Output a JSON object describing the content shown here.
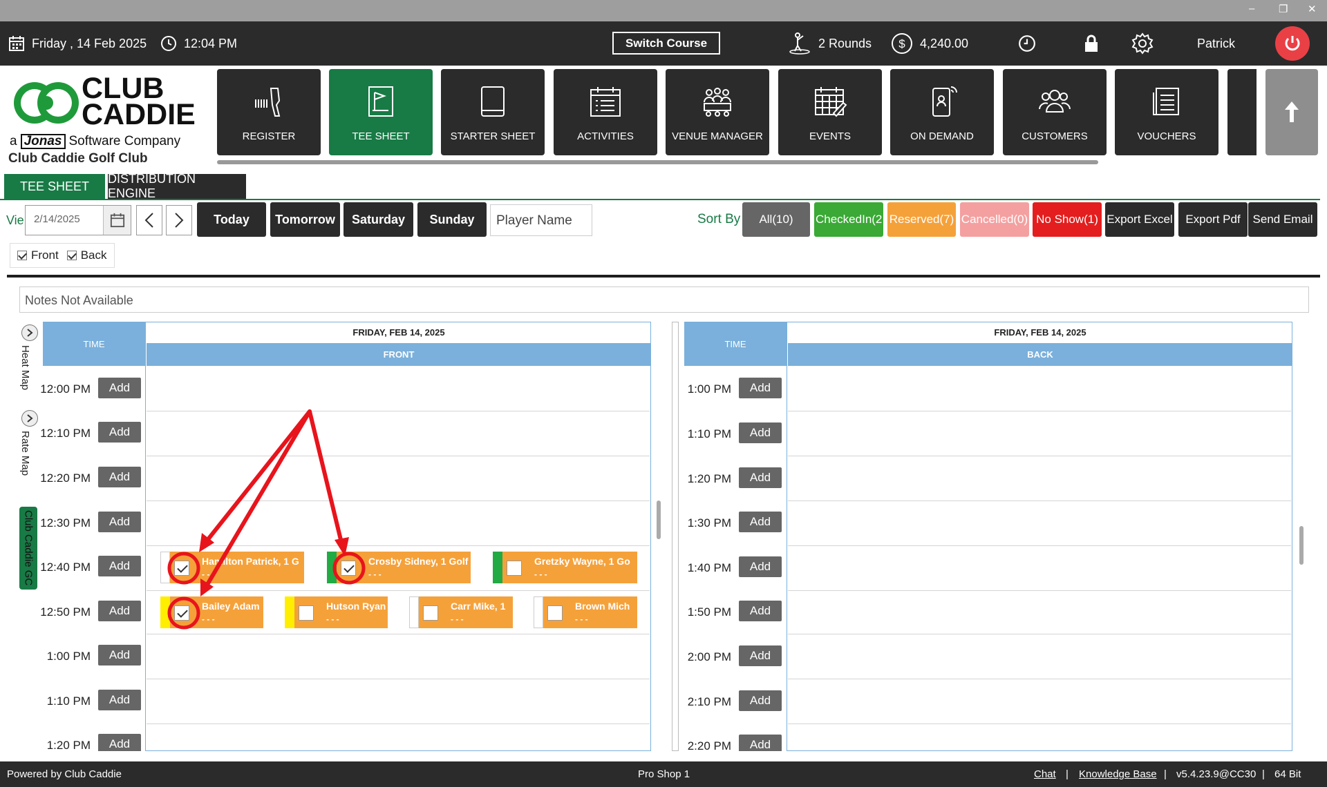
{
  "window": {
    "minimize": "–",
    "restore": "❐",
    "close": "✕"
  },
  "topbar": {
    "date": "Friday ,  14 Feb 2025",
    "time": "12:04 PM",
    "switch_course": "Switch Course",
    "rounds": "2 Rounds",
    "balance": "4,240.00",
    "user": "Patrick"
  },
  "logo": {
    "line1": "CLUB",
    "line2": "CADDIE",
    "tagline_a": "a",
    "tagline_brand": "Jonas",
    "tagline_rest": "Software Company"
  },
  "club_name": "Club Caddie Golf Club",
  "nav": [
    {
      "label": "REGISTER",
      "icon": "barcode-scanner-icon"
    },
    {
      "label": "TEE SHEET",
      "icon": "tee-sheet-icon"
    },
    {
      "label": "STARTER SHEET",
      "icon": "tablet-icon"
    },
    {
      "label": "ACTIVITIES",
      "icon": "calendar-list-icon"
    },
    {
      "label": "VENUE MANAGER",
      "icon": "venue-icon"
    },
    {
      "label": "EVENTS",
      "icon": "calendar-edit-icon"
    },
    {
      "label": "ON DEMAND",
      "icon": "phone-ring-icon"
    },
    {
      "label": "CUSTOMERS",
      "icon": "people-icon"
    },
    {
      "label": "VOUCHERS",
      "icon": "document-icon"
    }
  ],
  "tabs": {
    "tee_sheet": "TEE SHEET",
    "distribution": "DISTRIBUTION ENGINE"
  },
  "toolbar": {
    "view_label": "Vie",
    "date_value": "2/14/2025",
    "today": "Today",
    "tomorrow": "Tomorrow",
    "saturday": "Saturday",
    "sunday": "Sunday",
    "player_placeholder": "Player Name",
    "sort_by": "Sort By",
    "all": "All(10)",
    "checked_in": "CheckedIn(2",
    "reserved": "Reserved(7)",
    "cancelled": "Cancelled(0)",
    "no_show": "No Show(1)",
    "export_excel": "Export Excel",
    "export_pdf": "Export Pdf",
    "send_email": "Send Email"
  },
  "filters": {
    "front": "Front",
    "back": "Back",
    "front_checked": true,
    "back_checked": true
  },
  "notes": "Notes Not Available",
  "side_tabs": {
    "heat_map": "Heat Map",
    "rate_map": "Rate Map",
    "club": "Club Caddie GC"
  },
  "front": {
    "time_header": "TIME",
    "date_header": "FRIDAY, FEB 14, 2025",
    "column": "FRONT",
    "slots": [
      "12:00 PM",
      "12:10 PM",
      "12:20 PM",
      "12:30 PM",
      "12:40 PM",
      "12:50 PM",
      "1:00 PM",
      "1:10 PM",
      "1:20 PM"
    ],
    "add_label": "Add",
    "bookings": [
      {
        "name": "Hamilton Patrick, 1 G",
        "dash": "- - -",
        "checked": true,
        "strip": "#ffffff"
      },
      {
        "name": "Crosby Sidney, 1 Golf",
        "dash": "- - -",
        "checked": true,
        "strip": "#22aa44"
      },
      {
        "name": "Gretzky Wayne, 1 Go",
        "dash": "- - -",
        "checked": false,
        "strip": "#22aa44"
      },
      {
        "name": "Bailey Adam",
        "dash": "- - -",
        "checked": true,
        "strip": "#ffee00"
      },
      {
        "name": "Hutson Ryan",
        "dash": "- - -",
        "checked": false,
        "strip": "#ffee00"
      },
      {
        "name": "Carr Mike, 1",
        "dash": "- - -",
        "checked": false,
        "strip": "#ffffff"
      },
      {
        "name": "Brown Mich",
        "dash": "- - -",
        "checked": false,
        "strip": "#ffffff"
      }
    ]
  },
  "back": {
    "time_header": "TIME",
    "date_header": "FRIDAY, FEB 14, 2025",
    "column": "BACK",
    "slots": [
      "1:00 PM",
      "1:10 PM",
      "1:20 PM",
      "1:30 PM",
      "1:40 PM",
      "1:50 PM",
      "2:00 PM",
      "2:10 PM",
      "2:20 PM"
    ],
    "add_label": "Add"
  },
  "footer": {
    "powered": "Powered by Club Caddie",
    "station": "Pro Shop 1",
    "chat": "Chat",
    "sep": "|",
    "kb": "Knowledge Base",
    "version": "v5.4.23.9@CC30",
    "bits": "64 Bit"
  },
  "colors": {
    "brand_green": "#187a45",
    "dark": "#2b2b2b",
    "checked_in": "#3aa935",
    "reserved": "#f5a13a",
    "cancelled": "#f4a0a0",
    "no_show": "#e41e1e",
    "header_blue": "#7ab0db",
    "annotation_red": "#e8141c"
  }
}
